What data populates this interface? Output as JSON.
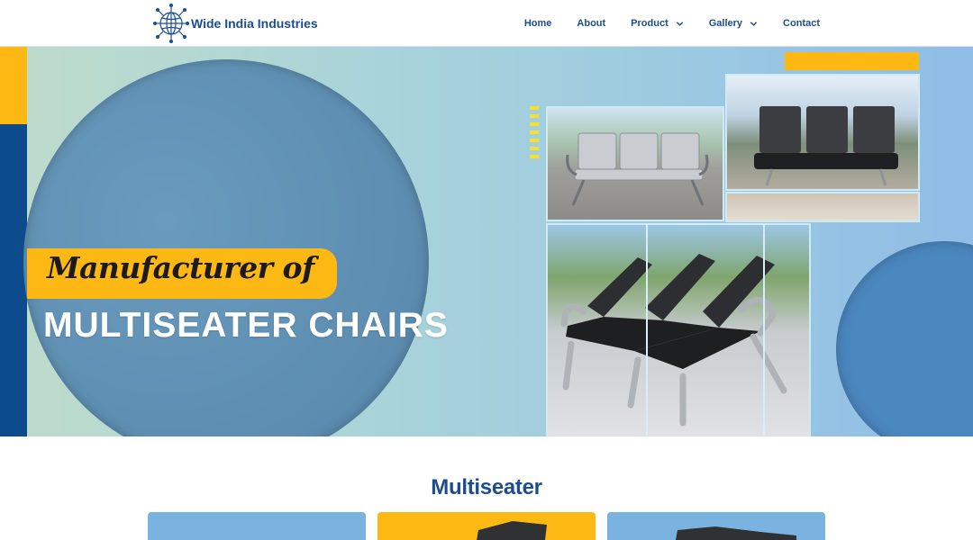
{
  "brand": {
    "name": "Wide India Industries",
    "logo_icon": "globe-network-icon"
  },
  "nav": {
    "items": [
      {
        "label": "Home",
        "has_dropdown": false
      },
      {
        "label": "About",
        "has_dropdown": false
      },
      {
        "label": "Product",
        "has_dropdown": true
      },
      {
        "label": "Gallery",
        "has_dropdown": true
      },
      {
        "label": "Contact",
        "has_dropdown": false
      }
    ]
  },
  "hero": {
    "script_text": "Manufacturer of",
    "title": "MULTISEATER CHAIRS"
  },
  "section": {
    "title": "Multiseater"
  },
  "colors": {
    "brand_blue": "#1c4d8f",
    "accent_yellow": "#fdb813",
    "dark_blue": "#0c4b8c",
    "light_blue": "#7ab3e0"
  }
}
